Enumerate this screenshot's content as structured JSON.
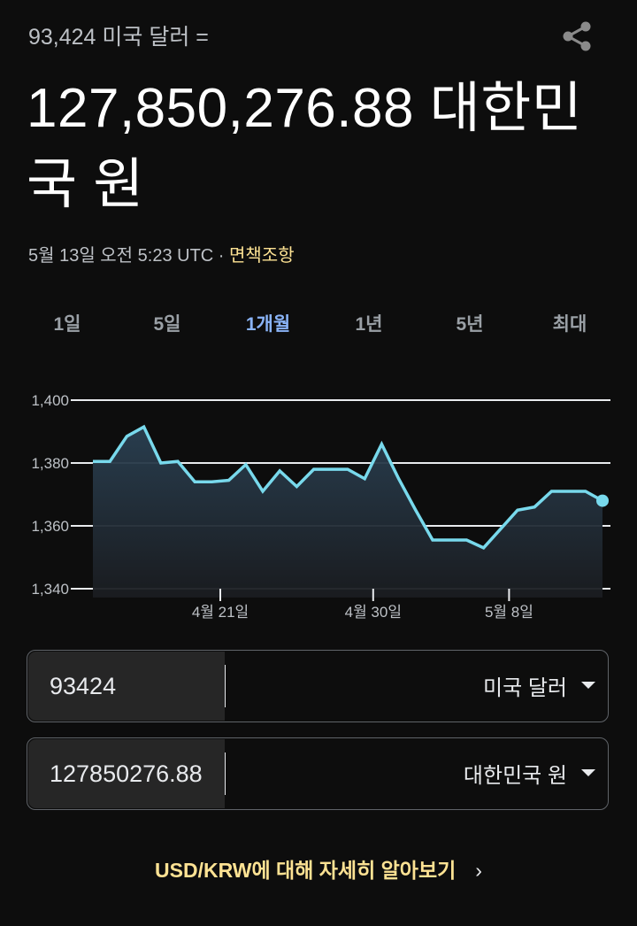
{
  "header": {
    "subtitle": "93,424 미국 달러 =",
    "result": "127,850,276.88 대한민국 원",
    "timestamp": "5월 13일 오전 5:23 UTC · ",
    "disclaimer": "면책조항",
    "share_icon": "share-icon"
  },
  "tabs": [
    {
      "label": "1일",
      "active": false
    },
    {
      "label": "5일",
      "active": false
    },
    {
      "label": "1개월",
      "active": true
    },
    {
      "label": "1년",
      "active": false
    },
    {
      "label": "5년",
      "active": false
    },
    {
      "label": "최대",
      "active": false
    }
  ],
  "colors": {
    "line": "#78d9ec",
    "accent_tab": "#8ab4f8",
    "disclaimer": "#fde293",
    "background": "#0d0d0d"
  },
  "chart_data": {
    "type": "area",
    "title": "",
    "xlabel": "",
    "ylabel": "",
    "ylim": [
      1340,
      1400
    ],
    "yticks": [
      1400,
      1380,
      1360,
      1340
    ],
    "ytick_labels": [
      "1,400",
      "1,380",
      "1,360",
      "1,340"
    ],
    "xtick_labels": [
      {
        "label": "4월 21일",
        "index": 7.5
      },
      {
        "label": "4월 30일",
        "index": 16.5
      },
      {
        "label": "5월 8일",
        "index": 24.5
      }
    ],
    "grid": true,
    "legend": "none",
    "series": [
      {
        "name": "USD/KRW",
        "values": [
          1380.5,
          1380.5,
          1388.5,
          1391.5,
          1380,
          1380.5,
          1374,
          1374,
          1374.5,
          1379.5,
          1371,
          1377.5,
          1372.5,
          1378,
          1378,
          1378,
          1375,
          1386,
          1375,
          1365,
          1355.5,
          1355.5,
          1355.5,
          1353,
          1359,
          1365,
          1366,
          1371,
          1371,
          1371,
          1368
        ]
      }
    ]
  },
  "converter": {
    "from": {
      "value": "93424",
      "currency": "미국 달러"
    },
    "to": {
      "value": "127850276.88",
      "currency": "대한민국 원"
    }
  },
  "footer": {
    "learn_more": "USD/KRW에 대해 자세히 알아보기",
    "chevron": "›"
  }
}
